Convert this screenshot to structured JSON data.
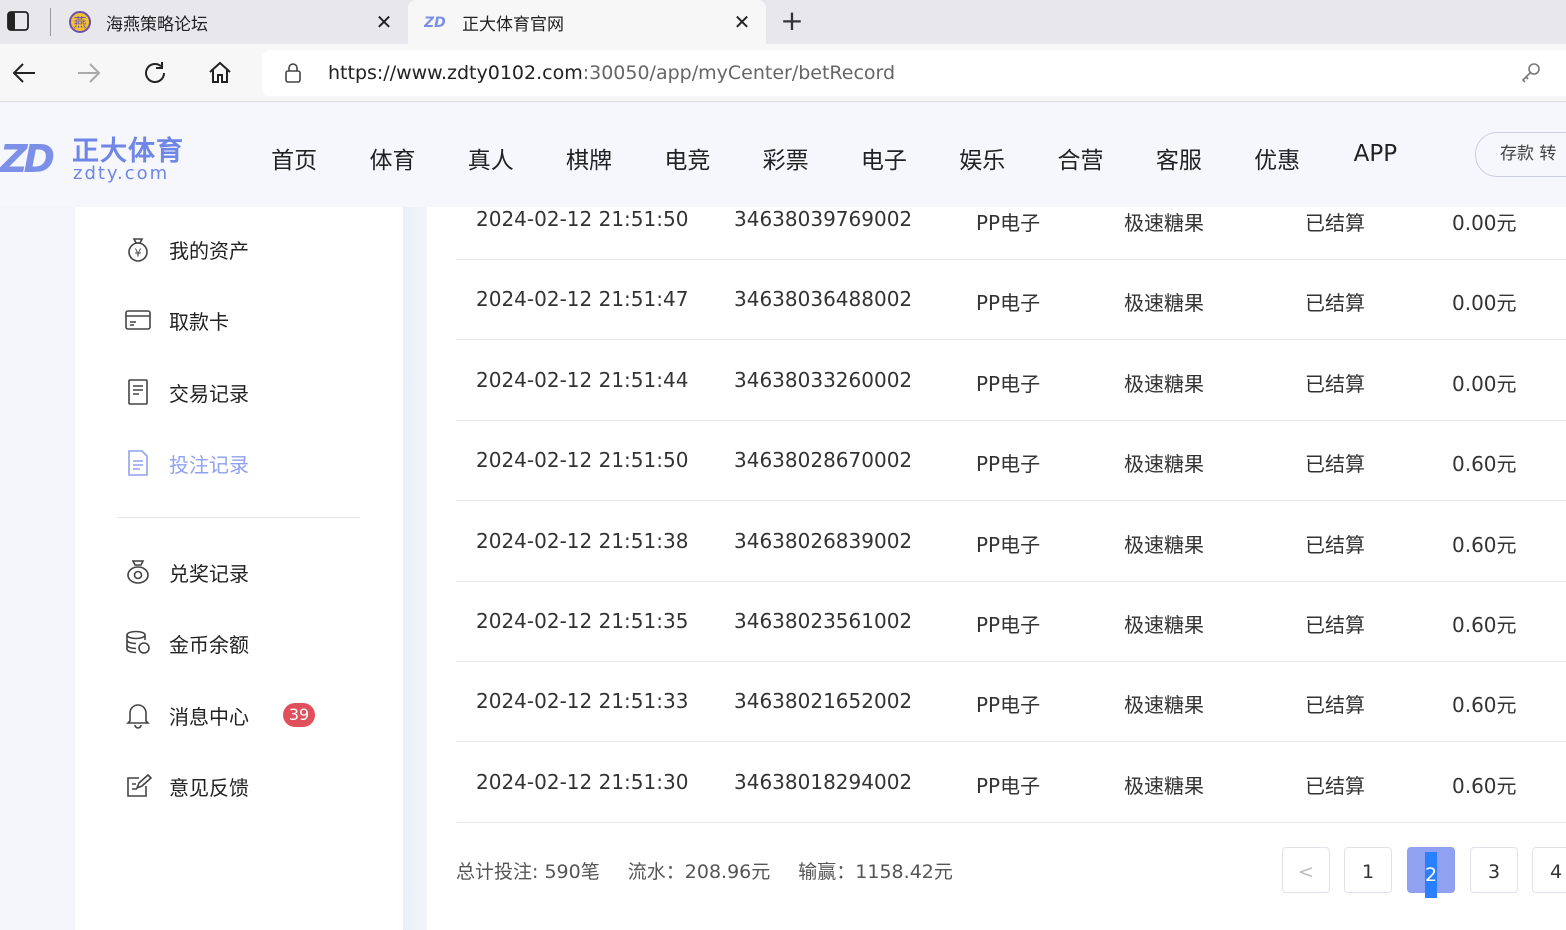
{
  "browser": {
    "tabs": [
      {
        "title": "海燕策略论坛"
      },
      {
        "title": "正大体育官网"
      }
    ],
    "url_host": "https://www.zdty0102.com",
    "url_path": ":30050/app/myCenter/betRecord"
  },
  "site": {
    "logo_mark": "ZD",
    "logo_cn": "正大体育",
    "logo_en": "zdty.com",
    "nav": [
      "首页",
      "体育",
      "真人",
      "棋牌",
      "电竞",
      "彩票",
      "电子",
      "娱乐",
      "合营",
      "客服",
      "优惠",
      "APP"
    ],
    "header_button": "存款 转"
  },
  "sidebar": {
    "items": [
      {
        "label": "我的资产",
        "icon": "money-bag-icon"
      },
      {
        "label": "取款卡",
        "icon": "card-icon"
      },
      {
        "label": "交易记录",
        "icon": "document-icon"
      },
      {
        "label": "投注记录",
        "icon": "bet-record-icon"
      },
      {
        "label": "兑奖记录",
        "icon": "prize-bag-icon"
      },
      {
        "label": "金币余额",
        "icon": "coins-icon"
      },
      {
        "label": "消息中心",
        "icon": "bell-icon",
        "badge": "39"
      },
      {
        "label": "意见反馈",
        "icon": "feedback-icon"
      }
    ],
    "active_color": "#8fa1f0"
  },
  "records": [
    {
      "time": "2024-02-12 21:51:50",
      "id": "34638039769002",
      "game": "PP电子",
      "name": "极速糖果",
      "status": "已结算",
      "amount": "0.00元"
    },
    {
      "time": "2024-02-12 21:51:47",
      "id": "34638036488002",
      "game": "PP电子",
      "name": "极速糖果",
      "status": "已结算",
      "amount": "0.00元"
    },
    {
      "time": "2024-02-12 21:51:44",
      "id": "34638033260002",
      "game": "PP电子",
      "name": "极速糖果",
      "status": "已结算",
      "amount": "0.00元"
    },
    {
      "time": "2024-02-12 21:51:50",
      "id": "34638028670002",
      "game": "PP电子",
      "name": "极速糖果",
      "status": "已结算",
      "amount": "0.60元"
    },
    {
      "time": "2024-02-12 21:51:38",
      "id": "34638026839002",
      "game": "PP电子",
      "name": "极速糖果",
      "status": "已结算",
      "amount": "0.60元"
    },
    {
      "time": "2024-02-12 21:51:35",
      "id": "34638023561002",
      "game": "PP电子",
      "name": "极速糖果",
      "status": "已结算",
      "amount": "0.60元"
    },
    {
      "time": "2024-02-12 21:51:33",
      "id": "34638021652002",
      "game": "PP电子",
      "name": "极速糖果",
      "status": "已结算",
      "amount": "0.60元"
    },
    {
      "time": "2024-02-12 21:51:30",
      "id": "34638018294002",
      "game": "PP电子",
      "name": "极速糖果",
      "status": "已结算",
      "amount": "0.60元"
    }
  ],
  "summary": {
    "total": "总计投注: 590笔",
    "flow": "流水：208.96元",
    "winloss": "输赢：1158.42元"
  },
  "pagination": {
    "prev": "<",
    "pages": [
      "1",
      "2",
      "3",
      "4"
    ],
    "current": "2"
  }
}
